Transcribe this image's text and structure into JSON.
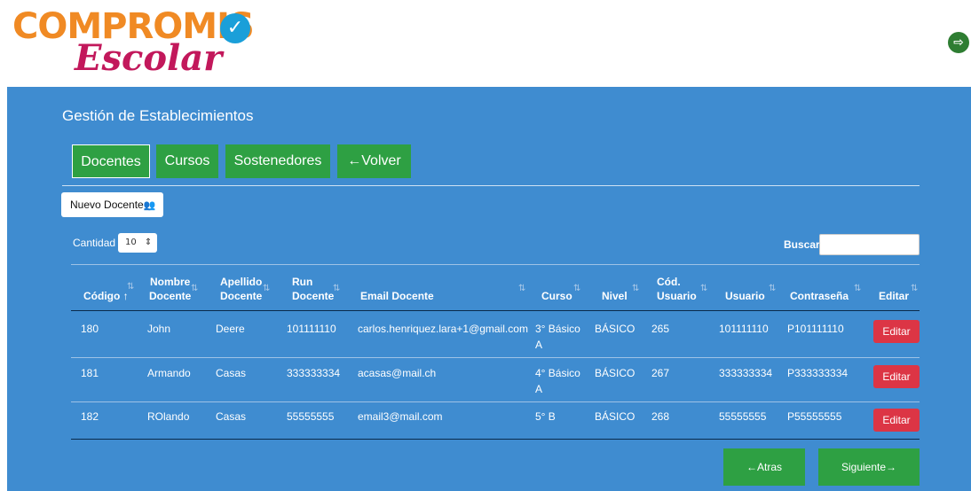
{
  "brand": {
    "logo_top": "COMPROMIS",
    "logo_check": "✓",
    "logo_bottom": "Escolar",
    "logout_icon": "⇨"
  },
  "page": {
    "title": "Gestión de Establecimientos"
  },
  "tabs": [
    {
      "label": "Docentes"
    },
    {
      "label": "Cursos"
    },
    {
      "label": "Sostenedores"
    },
    {
      "label": "Volver",
      "icon": "←"
    }
  ],
  "actions": {
    "new_label": "Nuevo Docente",
    "new_icon": "👥"
  },
  "controls": {
    "quantity_label": "Cantidad",
    "quantity_value": "10",
    "quantity_arrow": "⇕",
    "search_label": "Buscar",
    "search_value": ""
  },
  "table": {
    "columns": [
      {
        "l1": "",
        "l2": "Código"
      },
      {
        "l1": "Nombre",
        "l2": "Docente"
      },
      {
        "l1": "Apellido",
        "l2": "Docente"
      },
      {
        "l1": "Run",
        "l2": "Docente"
      },
      {
        "l1": "",
        "l2": "Email Docente"
      },
      {
        "l1": "",
        "l2": "Curso"
      },
      {
        "l1": "",
        "l2": "Nivel"
      },
      {
        "l1": "Cód.",
        "l2": "Usuario"
      },
      {
        "l1": "",
        "l2": "Usuario"
      },
      {
        "l1": "",
        "l2": "Contraseña"
      },
      {
        "l1": "",
        "l2": "Editar"
      }
    ],
    "sort_icon": "⇅",
    "sort_active_icon": "↑",
    "edit_label": "Editar",
    "rows": [
      {
        "codigo": "180",
        "nombre": "John",
        "apellido": "Deere",
        "run": "101111110",
        "email": "carlos.henriquez.lara+1@gmail.com",
        "curso_l1": "3° Básico",
        "curso_l2": "A",
        "nivel": "BÁSICO",
        "cod_usuario": "265",
        "usuario": "101111110",
        "contrasena": "P101111110"
      },
      {
        "codigo": "181",
        "nombre": "Armando",
        "apellido": "Casas",
        "run": "333333334",
        "email": "acasas@mail.ch",
        "curso_l1": "4° Básico",
        "curso_l2": "A",
        "nivel": "BÁSICO",
        "cod_usuario": "267",
        "usuario": "333333334",
        "contrasena": "P333333334"
      },
      {
        "codigo": "182",
        "nombre": "ROlando",
        "apellido": "Casas",
        "run": "55555555",
        "email": "email3@mail.com",
        "curso_l1": "5° B",
        "curso_l2": "",
        "nivel": "BÁSICO",
        "cod_usuario": "268",
        "usuario": "55555555",
        "contrasena": "P55555555"
      }
    ]
  },
  "pagination": {
    "prev_label": "Atras",
    "prev_icon": "←",
    "next_label": "Siguiente",
    "next_icon": "→"
  },
  "colors": {
    "panel": "#3f8cd0",
    "success": "#2ea043",
    "danger": "#dc3545",
    "brand_orange": "#f08a24",
    "brand_magenta": "#c2185b",
    "brand_blue": "#1a9fd9"
  }
}
